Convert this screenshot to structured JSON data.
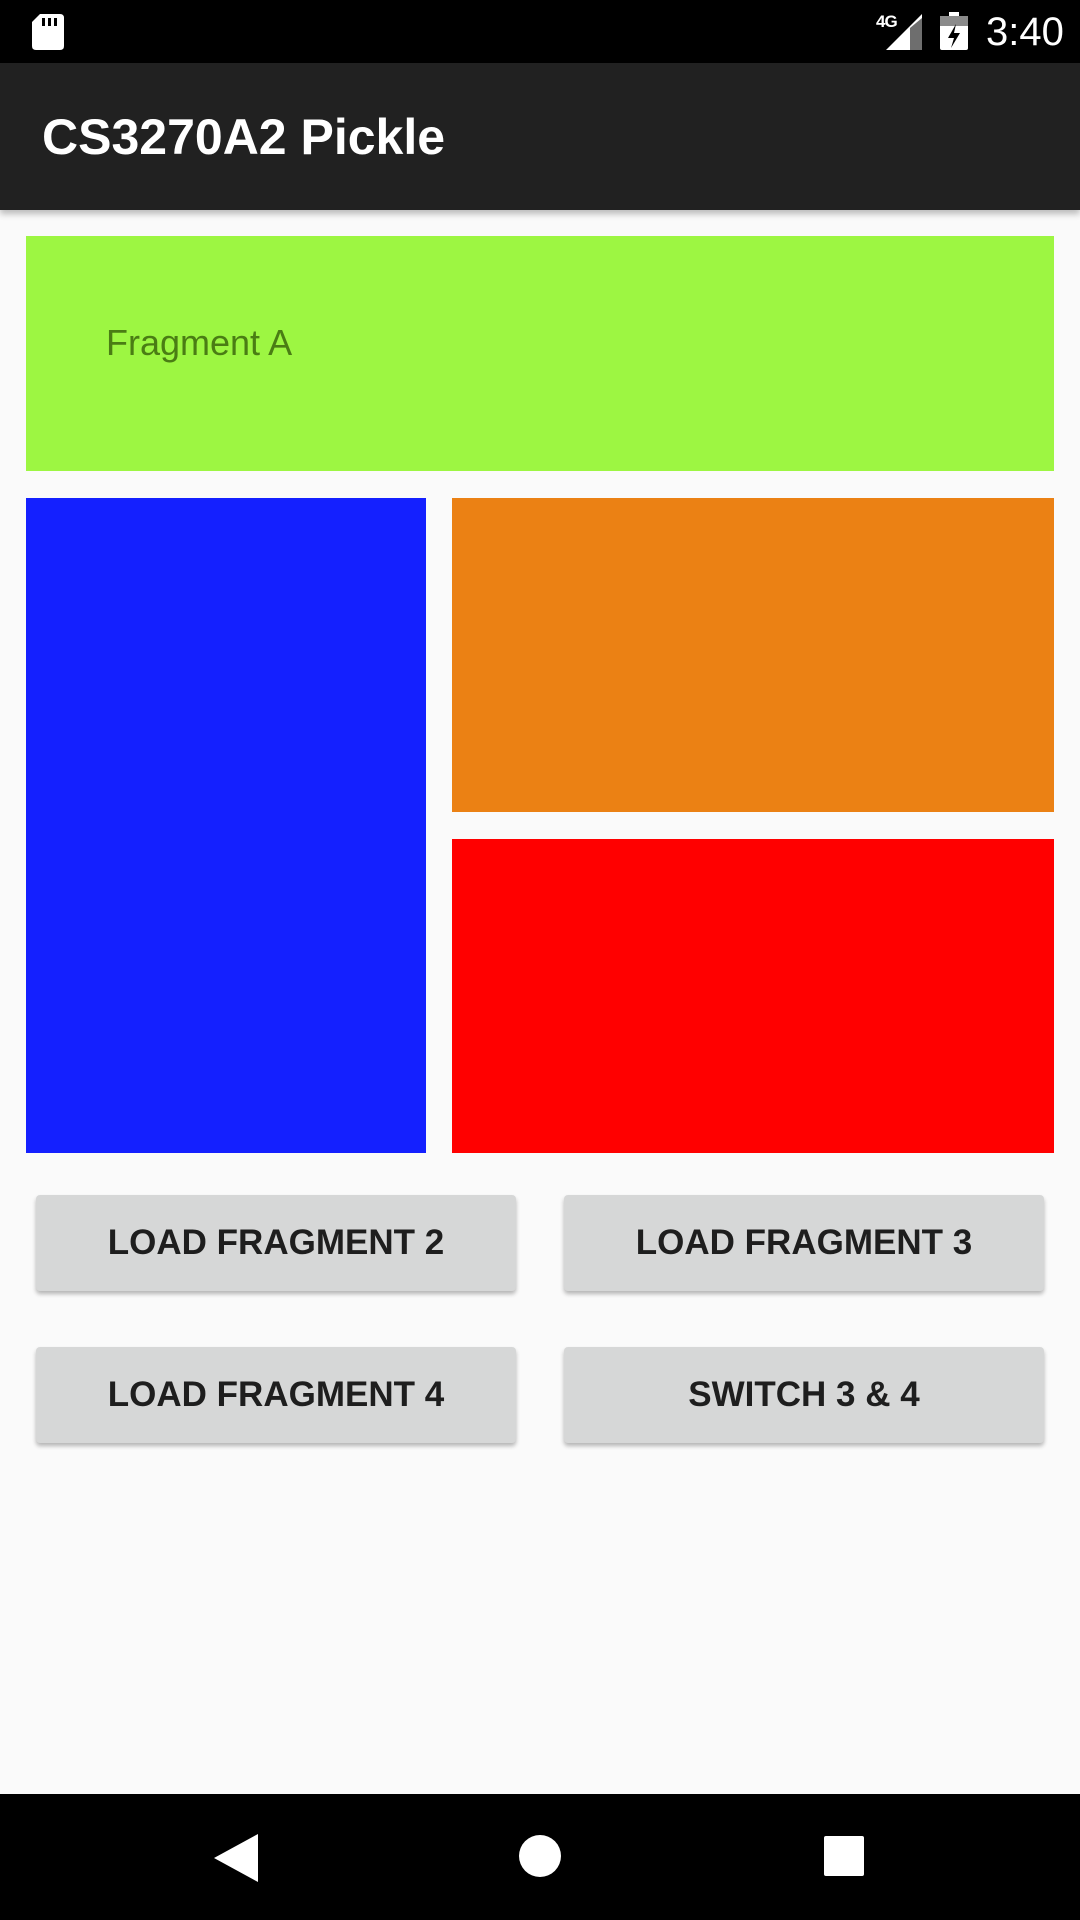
{
  "status_bar": {
    "time": "3:40",
    "network": "4G",
    "icons": [
      "sd-card-icon",
      "signal-icon",
      "battery-charging-icon"
    ]
  },
  "app_bar": {
    "title": "CS3270A2 Pickle"
  },
  "fragments": {
    "a": {
      "label": "Fragment A",
      "color": "#9df642"
    },
    "left": {
      "color": "#1420ff"
    },
    "top_right": {
      "color": "#eb8114"
    },
    "bottom_right": {
      "color": "#ff0000"
    }
  },
  "buttons": {
    "load_2": "LOAD FRAGMENT 2",
    "load_3": "LOAD FRAGMENT 3",
    "load_4": "LOAD FRAGMENT 4",
    "switch": "SWITCH 3 & 4"
  },
  "nav_bar": {
    "icons": [
      "back-icon",
      "home-icon",
      "recent-apps-icon"
    ]
  }
}
